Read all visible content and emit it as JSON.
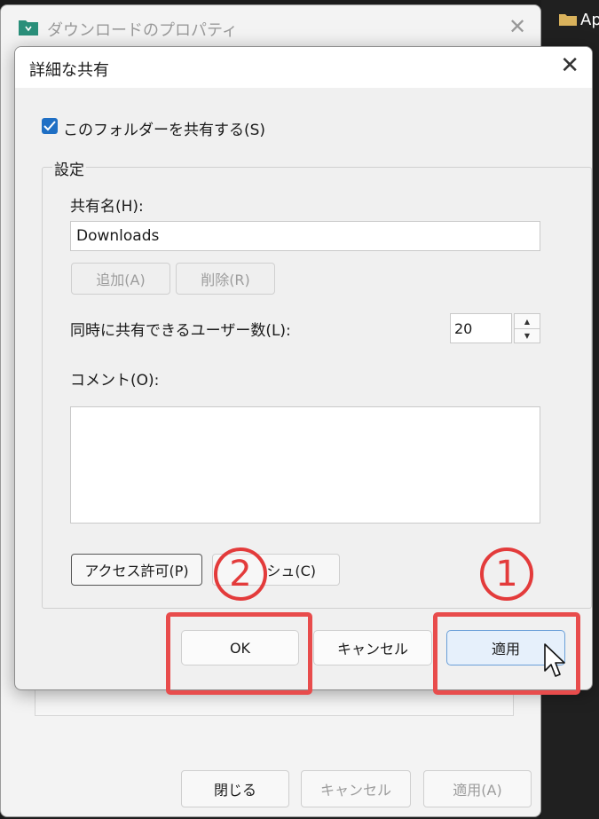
{
  "background_window": {
    "title": "ダウンロードのプロパティ",
    "close_glyph": "✕",
    "buttons": {
      "close": "閉じる",
      "cancel": "キャンセル",
      "apply": "適用(A)"
    }
  },
  "right_panel": {
    "folder_label": "Ap"
  },
  "dialog": {
    "title": "詳細な共有",
    "close_glyph": "✕",
    "share_checkbox": {
      "label": "このフォルダーを共有する(S)",
      "checked": true
    },
    "settings_group": "設定",
    "share_name_label": "共有名(H):",
    "share_name_value": "Downloads",
    "add_button": "追加(A)",
    "remove_button": "削除(R)",
    "user_limit_label": "同時に共有できるユーザー数(L):",
    "user_limit_value": "20",
    "comment_label": "コメント(O):",
    "comment_value": "",
    "permissions_button": "アクセス許可(P)",
    "caching_button_partial": "シュ(C)",
    "ok_button": "OK",
    "cancel_button": "キャンセル",
    "apply_button": "適用"
  },
  "annotations": {
    "step1": "1",
    "step2": "2"
  },
  "colors": {
    "highlight": "#e84c4c",
    "checkbox": "#1f6fc4"
  }
}
